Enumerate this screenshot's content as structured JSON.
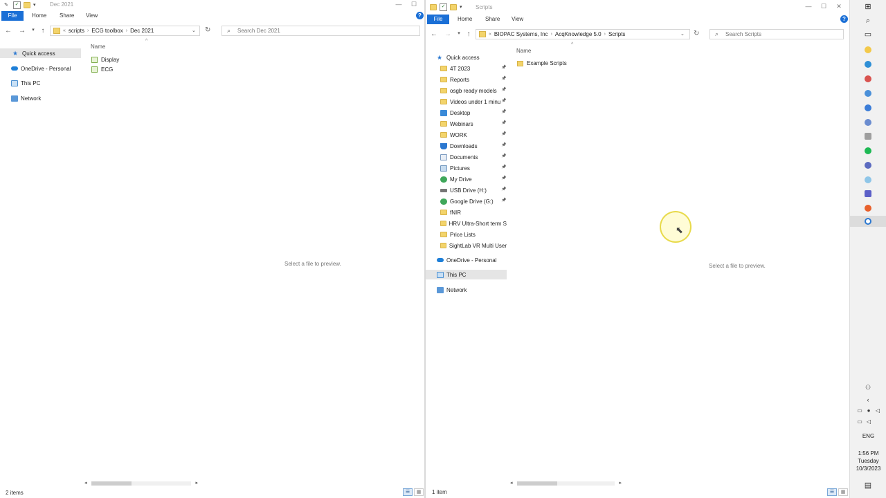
{
  "left_window": {
    "title": "Dec 2021",
    "tabs": [
      "File",
      "Home",
      "Share",
      "View"
    ],
    "address": {
      "overflow": "«",
      "crumbs": [
        "scripts",
        "ECG toolbox",
        "Dec 2021"
      ]
    },
    "search_placeholder": "Search Dec 2021",
    "nav": [
      {
        "label": "Quick access",
        "icon": "star-icon",
        "selected": true
      },
      {
        "label": "OneDrive - Personal",
        "icon": "cloud-icon"
      },
      {
        "label": "This PC",
        "icon": "monitor-icon"
      },
      {
        "label": "Network",
        "icon": "network-icon"
      }
    ],
    "column_name": "Name",
    "files": [
      {
        "label": "Display",
        "icon": "script-file-icon"
      },
      {
        "label": "ECG",
        "icon": "script-file-icon"
      }
    ],
    "preview_text": "Select a file to preview.",
    "status": "2 items"
  },
  "right_window": {
    "title": "Scripts",
    "tabs": [
      "File",
      "Home",
      "Share",
      "View"
    ],
    "address": {
      "overflow": "«",
      "crumbs": [
        "BIOPAC Systems, Inc",
        "AcqKnowledge 5.0",
        "Scripts"
      ]
    },
    "search_placeholder": "Search Scripts",
    "quick_access_label": "Quick access",
    "pinned": [
      {
        "label": "4T 2023",
        "icon": "folder-icon",
        "pinned": true
      },
      {
        "label": "Reports",
        "icon": "folder-icon",
        "pinned": true
      },
      {
        "label": "osgb ready models",
        "icon": "folder-icon",
        "pinned": true
      },
      {
        "label": "Videos under 1 minu",
        "icon": "folder-icon",
        "pinned": true
      },
      {
        "label": "Desktop",
        "icon": "desktop-icon",
        "pinned": true
      },
      {
        "label": "Webinars",
        "icon": "folder-icon",
        "pinned": true
      },
      {
        "label": "WORK",
        "icon": "folder-icon",
        "pinned": true
      },
      {
        "label": "Downloads",
        "icon": "download-icon",
        "pinned": true
      },
      {
        "label": "Documents",
        "icon": "documents-icon",
        "pinned": true
      },
      {
        "label": "Pictures",
        "icon": "pictures-icon",
        "pinned": true
      },
      {
        "label": "My Drive",
        "icon": "drive-icon",
        "pinned": true
      },
      {
        "label": "USB Drive (H:)",
        "icon": "usb-icon",
        "pinned": true
      },
      {
        "label": "Google Drive (G:)",
        "icon": "drive-icon",
        "pinned": true
      },
      {
        "label": "fNIR",
        "icon": "folder-icon",
        "pinned": false
      },
      {
        "label": "HRV Ultra-Short term S",
        "icon": "folder-icon",
        "pinned": false
      },
      {
        "label": "Price Lists",
        "icon": "folder-icon",
        "pinned": false
      },
      {
        "label": "SightLab VR Multi User",
        "icon": "folder-icon",
        "pinned": false
      }
    ],
    "onedrive_label": "OneDrive - Personal",
    "thispc_label": "This PC",
    "network_label": "Network",
    "column_name": "Name",
    "files": [
      {
        "label": "Example Scripts",
        "icon": "folder-icon"
      }
    ],
    "preview_text": "Select a file to preview.",
    "status": "1 item"
  },
  "taskbar": {
    "lang": "ENG",
    "time": "1:56 PM",
    "day": "Tuesday",
    "date": "10/3/2023"
  },
  "colors": {
    "accent": "#1a6fd6",
    "folder": "#f3d46b",
    "selection": "#e5e5e5"
  }
}
